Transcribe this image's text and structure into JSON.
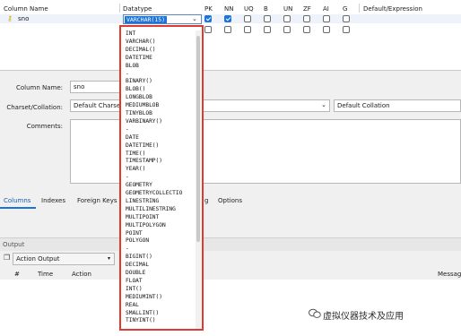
{
  "grid": {
    "headers": {
      "column_name": "Column Name",
      "datatype": "Datatype",
      "pk": "PK",
      "nn": "NN",
      "uq": "UQ",
      "b": "B",
      "un": "UN",
      "zf": "ZF",
      "ai": "AI",
      "g": "G",
      "default_expression": "Default/Expression"
    },
    "row": {
      "name": "sno",
      "datatype": "VARCHAR(15)",
      "pk": true,
      "nn": true
    }
  },
  "details": {
    "column_name_label": "Column Name:",
    "column_name_value": "sno",
    "charset_label": "Charset/Collation:",
    "charset_value": "Default Charset",
    "collation_value": "Default Collation",
    "comments_label": "Comments:"
  },
  "tabs": [
    "Columns",
    "Indexes",
    "Foreign Keys",
    "g",
    "Options"
  ],
  "output": {
    "title": "Output",
    "selector": "Action Output",
    "columns": [
      "#",
      "Time",
      "Action",
      "Message"
    ]
  },
  "datatype_options": [
    "INT",
    "VARCHAR()",
    "DECIMAL()",
    "DATETIME",
    "BLOB",
    "-",
    "BINARY()",
    "BLOB()",
    "LONGBLOB",
    "MEDIUMBLOB",
    "TINYBLOB",
    "VARBINARY()",
    "-",
    "DATE",
    "DATETIME()",
    "TIME()",
    "TIMESTAMP()",
    "YEAR()",
    "-",
    "GEOMETRY",
    "GEOMETRYCOLLECTIO",
    "LINESTRING",
    "MULTILINESTRING",
    "MULTIPOINT",
    "MULTIPOLYGON",
    "POINT",
    "POLYGON",
    "-",
    "BIGINT()",
    "DECIMAL",
    "DOUBLE",
    "FLOAT",
    "INT()",
    "MEDIUMINT()",
    "REAL",
    "SMALLINT()",
    "TINYINT()"
  ],
  "watermark": "虚拟仪器技术及应用",
  "colors": {
    "accent": "#1e73d8",
    "highlight_border": "#e03a2f"
  }
}
